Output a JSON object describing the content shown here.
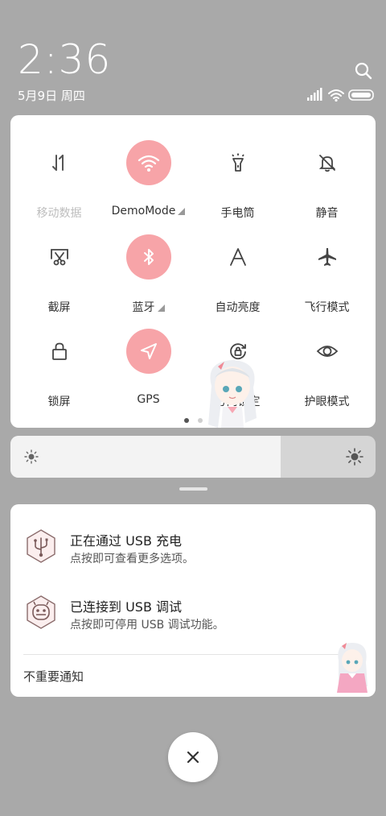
{
  "status_bar": {
    "time": "2:36",
    "date": "5月9日 周四"
  },
  "quick_settings": {
    "tiles": [
      {
        "label": "移动数据",
        "icon": "mobile-data-icon",
        "active": false,
        "dim": true
      },
      {
        "label": "DemoMode",
        "icon": "wifi-icon",
        "active": true,
        "expandable": true
      },
      {
        "label": "手电筒",
        "icon": "flashlight-icon",
        "active": false
      },
      {
        "label": "静音",
        "icon": "mute-bell-icon",
        "active": false
      },
      {
        "label": "截屏",
        "icon": "screenshot-icon",
        "active": false
      },
      {
        "label": "蓝牙",
        "icon": "bluetooth-icon",
        "active": true,
        "expandable": true
      },
      {
        "label": "自动亮度",
        "icon": "auto-brightness-icon",
        "active": false
      },
      {
        "label": "飞行模式",
        "icon": "airplane-icon",
        "active": false
      },
      {
        "label": "锁屏",
        "icon": "lock-icon",
        "active": false
      },
      {
        "label": "GPS",
        "icon": "location-arrow-icon",
        "active": true
      },
      {
        "label": "方向锁定",
        "icon": "rotation-lock-icon",
        "active": false
      },
      {
        "label": "护眼模式",
        "icon": "eye-icon",
        "active": false
      }
    ],
    "page_count": 2,
    "current_page": 1
  },
  "brightness": {
    "level": 0.74
  },
  "notifications": [
    {
      "title": "正在通过 USB 充电",
      "subtitle": "点按即可查看更多选项。",
      "icon": "usb-charging-icon"
    },
    {
      "title": "已连接到 USB 调试",
      "subtitle": "点按即可停用 USB 调试功能。",
      "icon": "usb-debug-icon"
    }
  ],
  "less_important": "不重要通知",
  "colors": {
    "accent": "#f7a4a8",
    "background": "#a9a9a9"
  }
}
